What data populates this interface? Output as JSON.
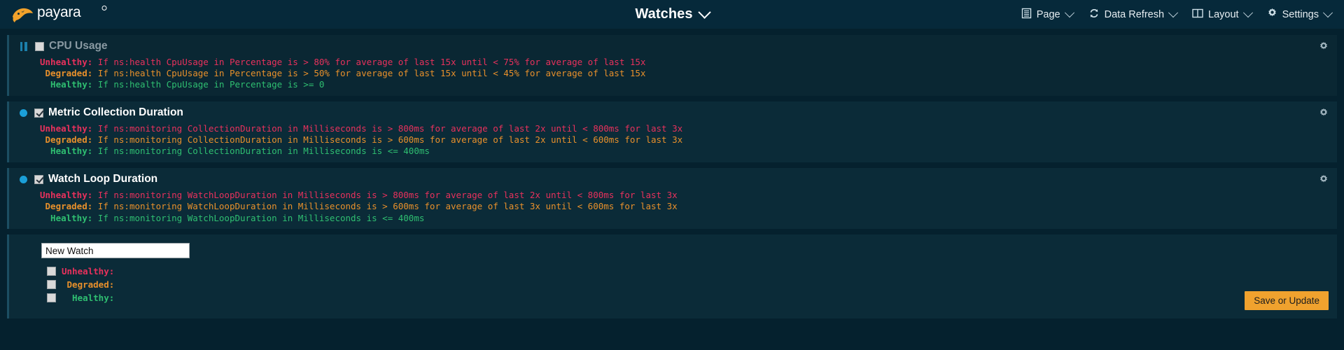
{
  "header": {
    "brand": "payara",
    "brand_mark": "payara-fish-logo",
    "title": "Watches",
    "title_caret": "chevron-down-icon",
    "nav": [
      {
        "label": "Page",
        "icon": "page-list-icon"
      },
      {
        "label": "Data Refresh",
        "icon": "refresh-icon"
      },
      {
        "label": "Layout",
        "icon": "layout-columns-icon"
      },
      {
        "label": "Settings",
        "icon": "gear-icon"
      }
    ]
  },
  "watches": [
    {
      "name": "CPU Usage",
      "enabled": false,
      "state": "paused",
      "state_icon": "pause-icon",
      "gear_icon": "gear-icon",
      "rules": [
        {
          "level": "Unhealthy",
          "text": "If ns:health CpuUsage in Percentage is > 80% for average of last 15x until < 75% for average of last 15x"
        },
        {
          "level": "Degraded",
          "text": "If ns:health CpuUsage in Percentage is > 50% for average of last 15x until < 45% for average of last 15x"
        },
        {
          "level": "Healthy",
          "text": "If ns:health CpuUsage in Percentage is >= 0"
        }
      ]
    },
    {
      "name": "Metric Collection Duration",
      "enabled": true,
      "state": "running",
      "state_icon": "status-dot-icon",
      "gear_icon": "gear-icon",
      "rules": [
        {
          "level": "Unhealthy",
          "text": "If ns:monitoring CollectionDuration in Milliseconds is > 800ms for average of last 2x until < 800ms for last 3x"
        },
        {
          "level": "Degraded",
          "text": "If ns:monitoring CollectionDuration in Milliseconds is > 600ms for average of last 2x until < 600ms for last 3x"
        },
        {
          "level": "Healthy",
          "text": "If ns:monitoring CollectionDuration in Milliseconds is <= 400ms"
        }
      ]
    },
    {
      "name": "Watch Loop Duration",
      "enabled": true,
      "state": "running",
      "state_icon": "status-dot-icon",
      "gear_icon": "gear-icon",
      "rules": [
        {
          "level": "Unhealthy",
          "text": "If ns:monitoring WatchLoopDuration in Milliseconds is > 800ms for average of last 2x until < 800ms for last 3x"
        },
        {
          "level": "Degraded",
          "text": "If ns:monitoring WatchLoopDuration in Milliseconds is > 600ms for average of last 3x until < 600ms for last 3x"
        },
        {
          "level": "Healthy",
          "text": "If ns:monitoring WatchLoopDuration in Milliseconds is <= 400ms"
        }
      ]
    }
  ],
  "new_watch": {
    "name_value": "New Watch",
    "name_placeholder": "New Watch",
    "levels": [
      {
        "label": "Unhealthy:",
        "checked": false
      },
      {
        "label": " Degraded:",
        "checked": false
      },
      {
        "label": "  Healthy:",
        "checked": false
      }
    ],
    "save_label": "Save or Update"
  },
  "colors": {
    "background": "#05212e",
    "header_bg": "#06293a",
    "card_bg": "#0b2b38",
    "accent_orange": "#f0a22e",
    "unhealthy": "#e8315c",
    "degraded": "#e8902b",
    "healthy": "#2fbf71",
    "running_dot": "#1b9fd8"
  }
}
